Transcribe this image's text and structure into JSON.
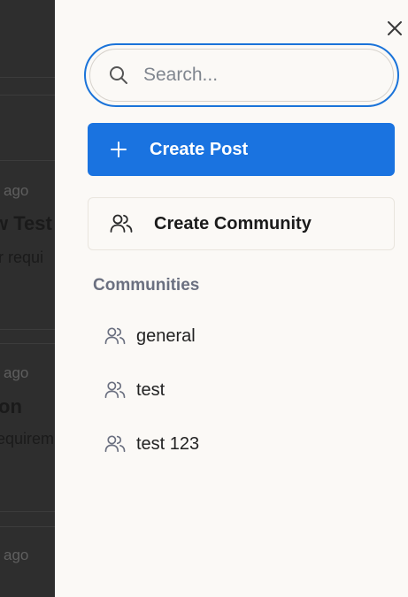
{
  "background_feed": {
    "items": [
      {
        "time": "ago",
        "title": "w Test",
        "body": "r requi"
      },
      {
        "time": "ago",
        "title": "on",
        "body": "equirem"
      },
      {
        "time": "ago"
      }
    ]
  },
  "drawer": {
    "search": {
      "placeholder": "Search...",
      "value": ""
    },
    "create_post_label": "Create Post",
    "create_community_label": "Create Community",
    "communities_heading": "Communities",
    "communities": [
      {
        "name": "general"
      },
      {
        "name": "test"
      },
      {
        "name": "test 123"
      }
    ]
  },
  "colors": {
    "accent": "#1a73e0",
    "focus_ring": "#1a73d9",
    "drawer_bg": "#fbf9f6",
    "backdrop": "#2e2e2e"
  }
}
